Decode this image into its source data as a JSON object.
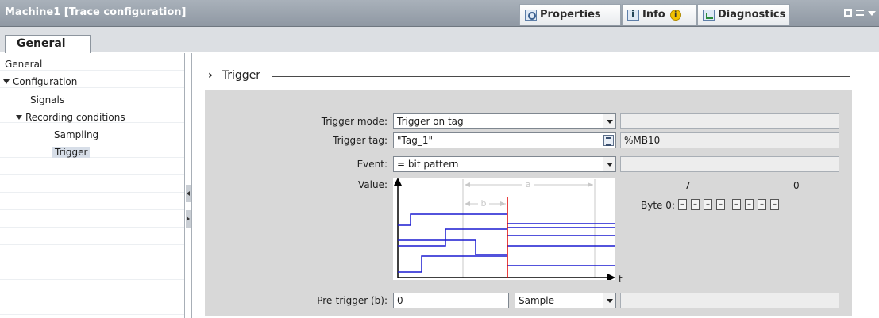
{
  "window": {
    "title": "Machine1 [Trace configuration]",
    "tabs": [
      {
        "label": "Properties",
        "icon": "magnifier-icon"
      },
      {
        "label": "Info",
        "icon": "info-icon",
        "badge": "i"
      },
      {
        "label": "Diagnostics",
        "icon": "diagnostics-icon"
      }
    ]
  },
  "tabstrip": {
    "active": "General"
  },
  "nav": {
    "items": [
      {
        "label": "General"
      },
      {
        "label": "Configuration"
      },
      {
        "label": "Signals"
      },
      {
        "label": "Recording conditions"
      },
      {
        "label": "Sampling"
      },
      {
        "label": "Trigger"
      }
    ]
  },
  "section": {
    "title": "Trigger"
  },
  "form": {
    "trigger_mode": {
      "label": "Trigger mode:",
      "value": "Trigger on tag",
      "side": ""
    },
    "trigger_tag": {
      "label": "Trigger tag:",
      "value": "\"Tag_1\"",
      "address": "%MB10"
    },
    "event": {
      "label": "Event:",
      "value": "= bit pattern",
      "side": ""
    },
    "value": {
      "label": "Value:"
    },
    "pretrigger": {
      "label": "Pre-trigger (b):",
      "value": "0",
      "unit": "Sample",
      "side": ""
    }
  },
  "diagram": {
    "a_label": "a",
    "b_label": "b",
    "t_label": "t",
    "signal_color": "#1a1ad0",
    "trigger_color": "#e00000"
  },
  "bits": {
    "msb": "7",
    "lsb": "0",
    "byte_label": "Byte 0:",
    "values": [
      "–",
      "–",
      "–",
      "–",
      "–",
      "–",
      "–",
      "–"
    ]
  }
}
